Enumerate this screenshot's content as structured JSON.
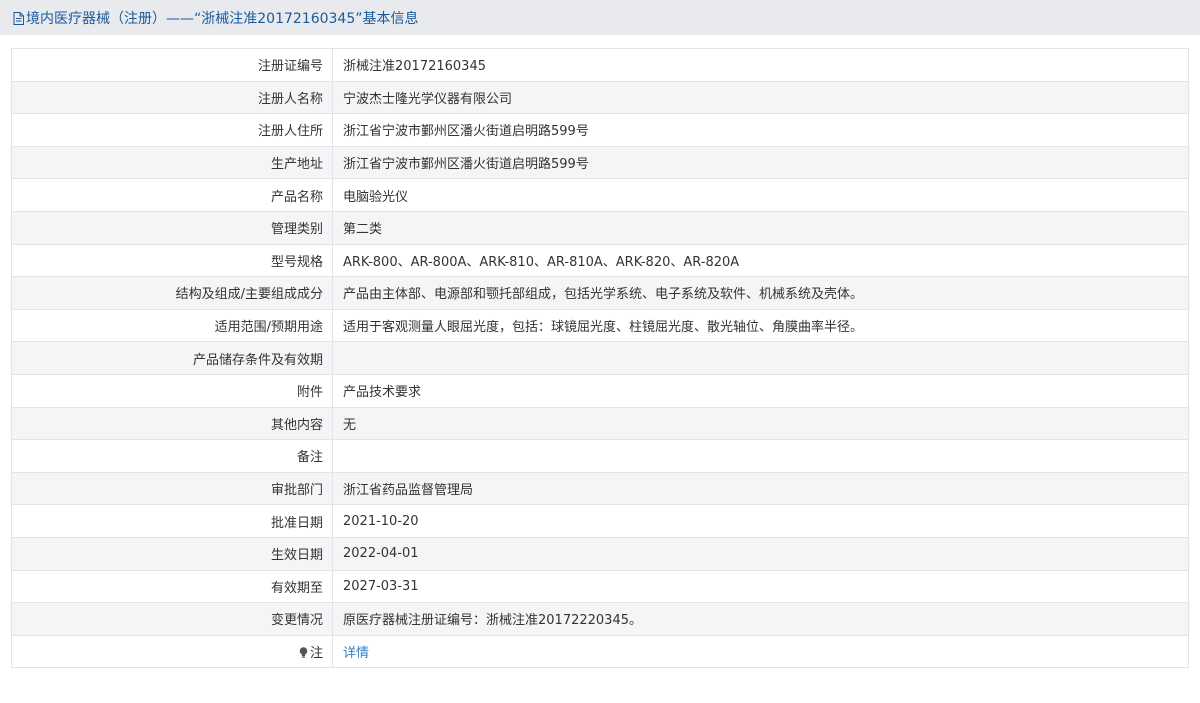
{
  "header": {
    "title": "境内医疗器械（注册）——“浙械注准20172160345”基本信息"
  },
  "rows": [
    {
      "label": "注册证编号",
      "value": "浙械注准20172160345"
    },
    {
      "label": "注册人名称",
      "value": "宁波杰士隆光学仪器有限公司"
    },
    {
      "label": "注册人住所",
      "value": "浙江省宁波市鄞州区潘火街道启明路599号"
    },
    {
      "label": "生产地址",
      "value": "浙江省宁波市鄞州区潘火街道启明路599号"
    },
    {
      "label": "产品名称",
      "value": "电脑验光仪"
    },
    {
      "label": "管理类别",
      "value": "第二类"
    },
    {
      "label": "型号规格",
      "value": "ARK-800、AR-800A、ARK-810、AR-810A、ARK-820、AR-820A"
    },
    {
      "label": "结构及组成/主要组成成分",
      "value": "产品由主体部、电源部和颚托部组成，包括光学系统、电子系统及软件、机械系统及壳体。"
    },
    {
      "label": "适用范围/预期用途",
      "value": "适用于客观测量人眼屈光度，包括：球镜屈光度、柱镜屈光度、散光轴位、角膜曲率半径。"
    },
    {
      "label": "产品储存条件及有效期",
      "value": ""
    },
    {
      "label": "附件",
      "value": "产品技术要求"
    },
    {
      "label": "其他内容",
      "value": "无"
    },
    {
      "label": "备注",
      "value": ""
    },
    {
      "label": "审批部门",
      "value": "浙江省药品监督管理局"
    },
    {
      "label": "批准日期",
      "value": "2021-10-20"
    },
    {
      "label": "生效日期",
      "value": "2022-04-01"
    },
    {
      "label": "有效期至",
      "value": "2027-03-31"
    },
    {
      "label": "变更情况",
      "value": "原医疗器械注册证编号：浙械注准20172220345。"
    }
  ],
  "note_row": {
    "icon": "lightbulb-icon",
    "label": "注",
    "link_text": "详情"
  },
  "colors": {
    "title_text": "#1a5a9c",
    "title_bg": "#e9eaee",
    "link": "#2d7fc6",
    "border": "#e2e4e8",
    "stripe": "#f4f5f7"
  }
}
